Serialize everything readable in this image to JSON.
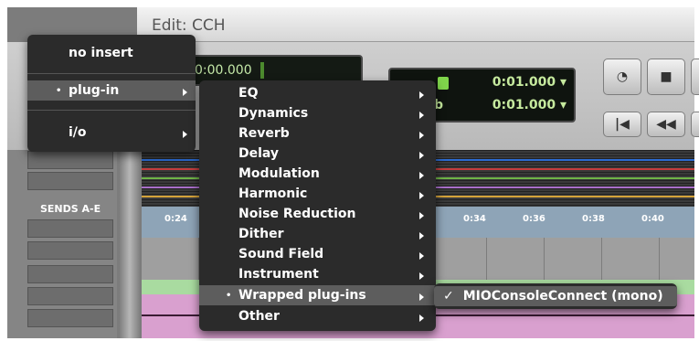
{
  "window": {
    "title": "Edit: CCH"
  },
  "counters": {
    "main_counter": "0:00.000",
    "start": "0:01.000 ▾",
    "end": "0:01.000 ▾",
    "start_prefix": "b"
  },
  "left_panel": {
    "sends_label": "SENDS A-E"
  },
  "timeline": {
    "ticks": [
      "0:24",
      "0:34",
      "0:36",
      "0:38",
      "0:40"
    ]
  },
  "insert_menu": {
    "items": [
      {
        "label": "no insert"
      },
      {
        "label": "plug-in",
        "selected": true,
        "has_submenu": true
      },
      {
        "label": "i/o",
        "has_submenu": true
      }
    ]
  },
  "plugin_menu": {
    "items": [
      {
        "label": "EQ"
      },
      {
        "label": "Dynamics"
      },
      {
        "label": "Reverb"
      },
      {
        "label": "Delay"
      },
      {
        "label": "Modulation"
      },
      {
        "label": "Harmonic"
      },
      {
        "label": "Noise Reduction"
      },
      {
        "label": "Dither"
      },
      {
        "label": "Sound Field"
      },
      {
        "label": "Instrument"
      },
      {
        "label": "Wrapped plug-ins",
        "selected": true
      },
      {
        "label": "Other"
      }
    ]
  },
  "wrapped_menu": {
    "items": [
      {
        "label": "MIOConsoleConnect (mono)",
        "checked": "✓"
      }
    ]
  },
  "colors": {
    "menu_bg": "#2b2b2b",
    "menu_highlight": "#5d5d5d",
    "timeline_bg": "#8ea4b7"
  }
}
